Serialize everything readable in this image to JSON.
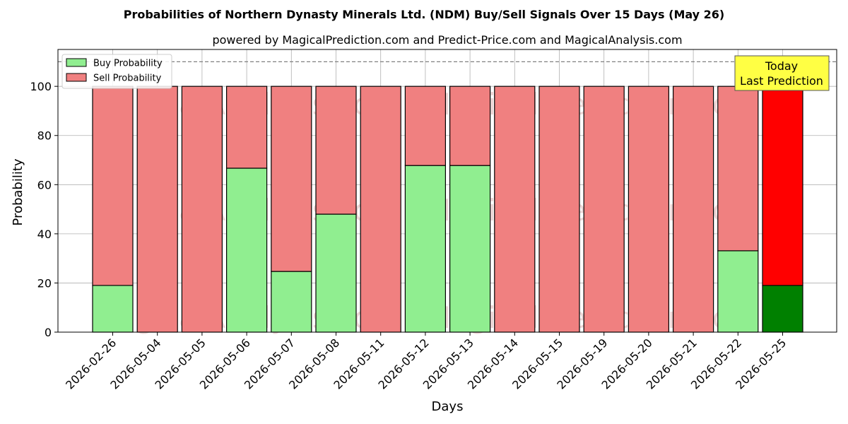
{
  "chart_data": {
    "type": "bar",
    "stacked": true,
    "title": "Probabilities of Northern Dynasty Minerals Ltd. (NDM) Buy/Sell Signals Over 15 Days (May 26)",
    "subtitle": "powered by MagicalPrediction.com and Predict-Price.com and MagicalAnalysis.com",
    "xlabel": "Days",
    "ylabel": "Probability",
    "ylim": [
      0,
      115
    ],
    "yticks": [
      0,
      20,
      40,
      60,
      80,
      100
    ],
    "reference_line": 110,
    "grid": true,
    "legend_position": "top-left",
    "categories": [
      "2026-02-26",
      "2026-05-04",
      "2026-05-05",
      "2026-05-06",
      "2026-05-07",
      "2026-05-08",
      "2026-05-11",
      "2026-05-12",
      "2026-05-13",
      "2026-05-14",
      "2026-05-15",
      "2026-05-19",
      "2026-05-20",
      "2026-05-21",
      "2026-05-22",
      "2026-05-25"
    ],
    "series": [
      {
        "name": "Buy Probability",
        "color": "#90ee90",
        "highlight_color": "#008000",
        "values": [
          19,
          0,
          0,
          66.7,
          24.7,
          48,
          0,
          67.8,
          67.8,
          0,
          0,
          0,
          0,
          0,
          33.1,
          19
        ]
      },
      {
        "name": "Sell Probability",
        "color": "#f08080",
        "highlight_color": "#ff0000",
        "values": [
          81,
          100,
          100,
          33.3,
          75.3,
          52,
          100,
          32.2,
          32.2,
          100,
          100,
          100,
          100,
          100,
          66.9,
          81
        ]
      }
    ],
    "highlight_index": 15,
    "annotation": {
      "line1": "Today",
      "line2": "Last Prediction",
      "color": "#ffff44"
    },
    "watermarks": [
      "MagicalAnalysis.com",
      "MagicalPrediction.com"
    ]
  }
}
